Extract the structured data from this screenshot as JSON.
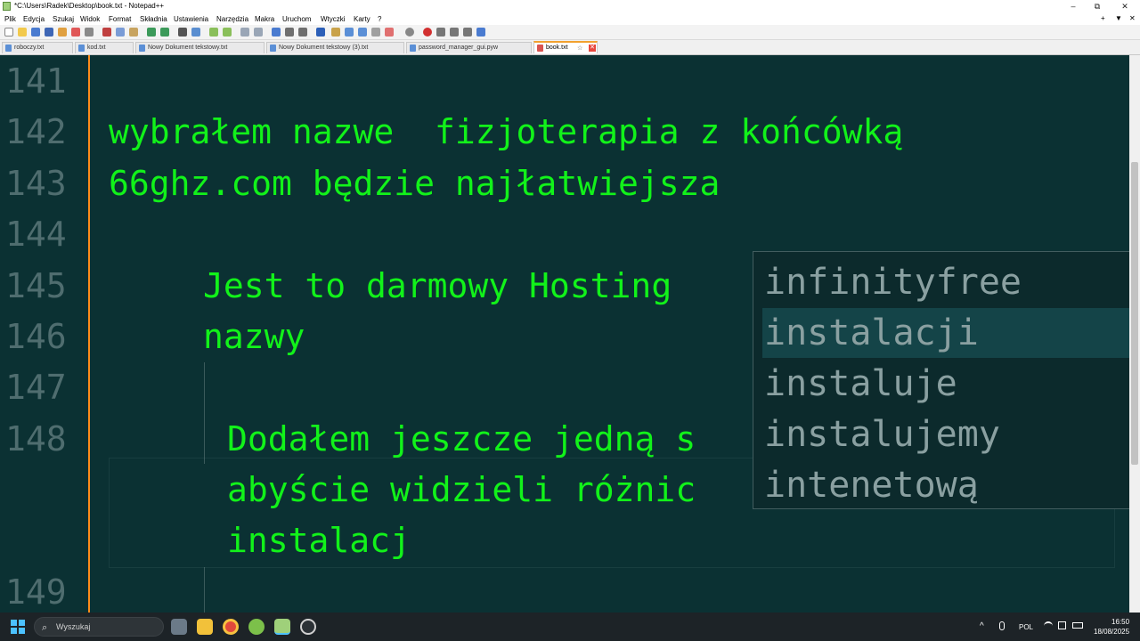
{
  "window": {
    "title": "*C:\\Users\\Radek\\Desktop\\book.txt - Notepad++"
  },
  "window_controls": {
    "minimize": "–",
    "maximize": "⧉",
    "close": "✕"
  },
  "menu": {
    "items": [
      "Plik",
      "Edycja",
      "Szukaj",
      "Widok",
      "Format",
      "Składnia",
      "Ustawienia",
      "Narzędzia",
      "Makra",
      "Uruchom",
      "Wtyczki",
      "Karty",
      "?"
    ],
    "right": [
      "+",
      "▼",
      "✕"
    ]
  },
  "tabs": [
    {
      "label": "roboczy.txt"
    },
    {
      "label": "kod.txt"
    },
    {
      "label": "Nowy Dokument tekstowy.txt"
    },
    {
      "label": "Nowy Dokument tekstowy (3).txt"
    },
    {
      "label": "password_manager_gui.pyw"
    },
    {
      "label": "book.txt",
      "active": true
    }
  ],
  "active_tab_pin": "☆",
  "active_tab_close": "✕",
  "editor": {
    "line_numbers": [
      "141",
      "142",
      "143",
      "144",
      "145",
      "146",
      "147",
      "148",
      "149"
    ],
    "lines": [
      "wybrałem nazwe  fizjoterapia z końcówką",
      "66ghz.com będzie najłatwiejsza",
      "Jest to darmowy Hosting",
      "nazwy",
      "Dodałem jeszcze jedną s",
      "abyście widzieli różnic",
      "instalacj"
    ]
  },
  "autocomplete": {
    "items": [
      "infinityfree",
      "instalacji",
      "instaluje",
      "instalujemy",
      "intenetową"
    ],
    "selected_index": 1
  },
  "taskbar": {
    "search_placeholder": "Wyszukaj",
    "tray": {
      "chevron": "^",
      "lang": "POL",
      "time": "16:50",
      "date": "18/08/2025"
    }
  },
  "colors": {
    "editor_bg": "#0b3133",
    "text": "#12f21a",
    "line_numbers": "#4f6d6f",
    "margin_line": "#ff8c1a",
    "autocomplete_bg": "#0c2a2c",
    "autocomplete_selected": "#144448"
  }
}
